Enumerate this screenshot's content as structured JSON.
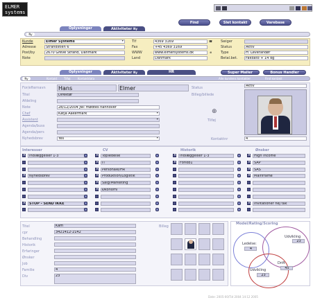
{
  "logo": {
    "line1": "ELMER",
    "line2": "systems"
  },
  "toolbar": {
    "find": "Find",
    "save_contact": "Slet kontakt",
    "goods": "Varebase"
  },
  "top_bar": {
    "pill_label": "Ny"
  },
  "top_tabs": [
    {
      "label": "Oplysninger",
      "active": true
    },
    {
      "label": "Aktiviteter",
      "active": false,
      "badge": "Ny"
    }
  ],
  "company": {
    "labels": {
      "customer": "Kunde",
      "address": "Adresse",
      "postal": "Post/by",
      "note": "Note",
      "phone": "Tlf",
      "fax": "Fax",
      "www": "WWW",
      "country": "Land",
      "skype": "Swiger",
      "status": "Status",
      "type": "Type",
      "terms": "Betal.bet."
    },
    "customer": "Elmer Systems",
    "address": "Strandstien 6",
    "postal": "2670 Greve Strand, Danmark",
    "note": "",
    "phone": "4369 3169",
    "fax": "+45 4369 3169",
    "www": "www.elmersystems.dk",
    "country": "Danmark",
    "skype": "",
    "status": "Aktiv",
    "type": "H: Leverandør",
    "terms": "Fakdato + 14 dg"
  },
  "contact_tabs": [
    {
      "label": "Oplysninger",
      "active": true
    },
    {
      "label": "Aktiviteter",
      "active": false,
      "badge": "Ny"
    },
    {
      "label": "HR",
      "active": false
    }
  ],
  "right_buttons": {
    "super_mailer": "Super Mailer",
    "bonus": "Bonus Handler"
  },
  "contact_bar": {
    "pill": "Ny",
    "contact_label": "Kontakt",
    "add": "Tilføj",
    "data": "Kontaktdata",
    "all_contacts": "Alle kundens kontakter",
    "find_contact": "Find kontakt"
  },
  "contact": {
    "labels": {
      "name": "For/efternavn",
      "title": "Titel",
      "dept": "Afdeling",
      "note": "Note",
      "chief": "Chef",
      "assistant": "Assistent",
      "agenda_biz": "Agenda/buss",
      "agenda_priv": "Agenda/pers",
      "newsletter": "Nyhedsbrev",
      "status": "Status",
      "photo": "Billeg/billede",
      "contact_no": "Kontaktnr"
    },
    "first_name": "Hans",
    "last_name": "Elmer",
    "title": "Direktør",
    "dept": "",
    "note": "28/12/2004 JW: mødtes hannover",
    "chief": "Katja Aakermark",
    "assistant": "",
    "newsletter": "Yes",
    "status": "Aktiv",
    "add_label": "Tilføj",
    "contact_no": "4"
  },
  "lists": {
    "interests": {
      "title": "Interesser",
      "items": [
        "Indlæggelser 1-3",
        "",
        "",
        "Nyhedsbrev",
        "",
        "",
        "",
        "STOP - SEND IKKE",
        ""
      ]
    },
    "cv": {
      "title": "CV",
      "items": [
        "Topledelse",
        "IT",
        "Personale/HR",
        "Produktion/Logistik",
        "Salg/Marketing",
        "Økonomi",
        "",
        "",
        ""
      ]
    },
    "history": {
      "title": "Historik",
      "items": [
        "Indlæggelser 1-3",
        "Forlob1",
        "",
        "",
        "",
        "",
        "",
        "",
        ""
      ]
    },
    "wishes": {
      "title": "Ønsker",
      "items": [
        "High income",
        "SAP",
        "SAS",
        "Mainframe",
        "",
        "",
        "",
        "Invitationer nej tak",
        ""
      ]
    }
  },
  "bottom": {
    "labels": {
      "title": "Titel",
      "cpr": "cpr",
      "treatment": "Behandling",
      "history": "Historik",
      "experience": "Erfaringer",
      "wishes": "Ønsker",
      "job": "Job",
      "family": "Familie",
      "div": "Div"
    },
    "title": "Kam",
    "cpr": "3421412-2142",
    "family": "4",
    "div": "23",
    "image_label": "Billeg"
  },
  "model": {
    "title": "Model/Rating/Scoring",
    "leadership": {
      "label": "Ledelse:",
      "value": "4"
    },
    "development1": {
      "label": "Udvikling",
      "value": "23"
    },
    "drive": {
      "label": "Drift",
      "value": "45"
    },
    "development2": {
      "label": "Udvikling",
      "value": "23"
    }
  },
  "footer": "Date: 2005-00/Tid 2004 14:12 2005"
}
